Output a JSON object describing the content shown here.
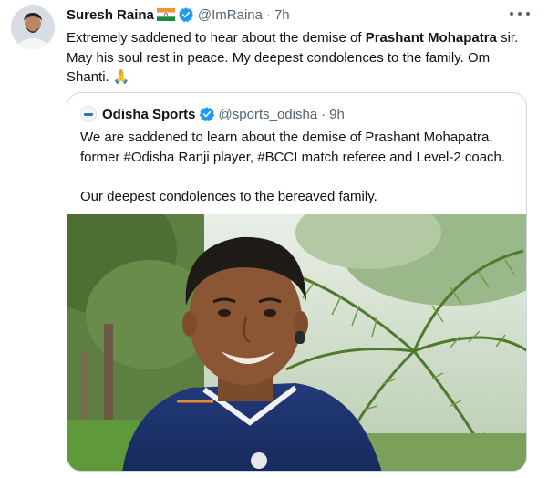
{
  "tweet": {
    "author_name": "Suresh Raina",
    "flag_icon": "india-flag-icon",
    "verified_icon": "verified-badge-icon",
    "handle": "@ImRaina",
    "separator": "·",
    "time": "7h",
    "more_icon": "more-horizontal-icon",
    "text_before": "Extremely saddened to hear about the demise of ",
    "text_bold": "Prashant Mohapatra",
    "text_after": " sir. May his soul rest in peace. My deepest condolences to the family. Om Shanti. 🙏"
  },
  "quoted_tweet": {
    "author_name": "Odisha Sports",
    "verified_icon": "verified-badge-icon",
    "handle": "@sports_odisha",
    "separator": "·",
    "time": "9h",
    "paragraph1": "We are saddened to learn about the demise of Prashant Mohapatra, former #Odisha Ranji player, #BCCI match referee and Level-2 coach.",
    "paragraph2": "Our deepest condolences to the bereaved family."
  },
  "colors": {
    "text_primary": "#0f1419",
    "text_secondary": "#536471",
    "verified_blue": "#1d9bf0",
    "border": "#cfd9de"
  }
}
